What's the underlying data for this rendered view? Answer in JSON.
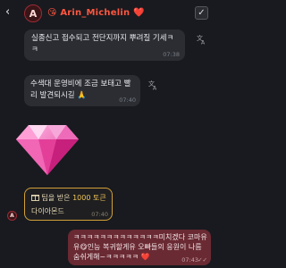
{
  "header": {
    "avatar_letter": "A",
    "name_prefix": "😘",
    "name": "Arin_Michelin",
    "name_suffix": "❤️"
  },
  "messages": [
    {
      "text": "실종신고 접수되고 전단지까지 뿌려질 기세ㅋㅋ",
      "time": "07:38"
    },
    {
      "text": "수색대 운영비에 조금 보태고 빨리 발견되시길 🙏",
      "time": "07:40"
    }
  ],
  "tip": {
    "label": "팁을 받은",
    "amount": "1000 토큰",
    "item": "다이아몬드",
    "time": "07:40"
  },
  "tip_avatar_letter": "A",
  "my_message": {
    "text": "ㅋㅋㅋㅋㅋㅋㅋㅋㅋㅋㅋㅋㅋ미치겠다 코마유유😋인능 복귀할게유 오빠들의 응원이 나름숨쉬게해~ㅋㅋㅋㅋㅋ ❤️",
    "time": "07:43",
    "status": "✓✓"
  },
  "colors": {
    "background": "#181a1f",
    "name": "#ff5640",
    "tip_border": "#d2a037",
    "my_bubble": "#6a2a33"
  },
  "icons": [
    "back-arrow-icon",
    "check-icon",
    "translate-icon",
    "gift-icon",
    "diamond-icon"
  ]
}
